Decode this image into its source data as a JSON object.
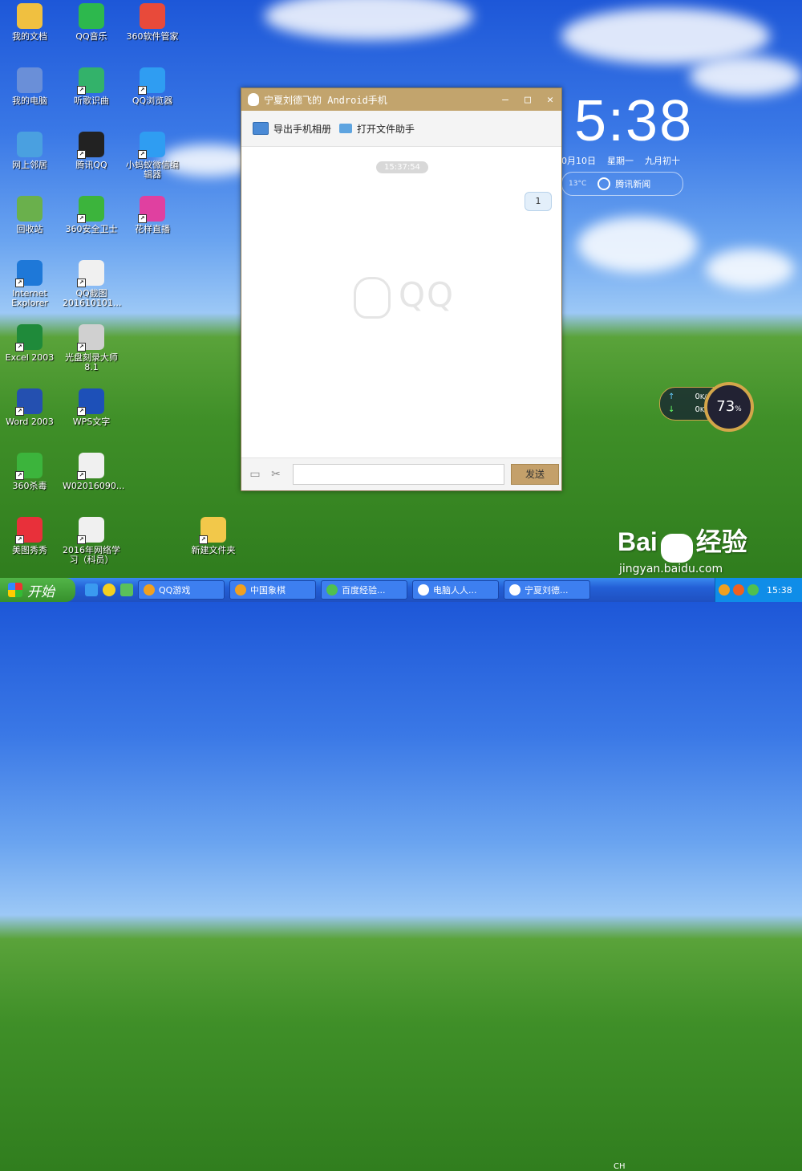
{
  "desktop": {
    "icons": [
      {
        "label": "我的文档",
        "icon": "folder-docs-icon",
        "color": "#f0c040"
      },
      {
        "label": "QQ音乐",
        "icon": "qq-music-icon",
        "color": "#2db84d"
      },
      {
        "label": "360软件管家",
        "icon": "360-software-icon",
        "color": "#e84a3a"
      },
      {
        "label": "我的电脑",
        "icon": "my-computer-icon",
        "color": "#6a8fd8"
      },
      {
        "label": "听歌识曲",
        "icon": "song-recognition-icon",
        "color": "#33b26a"
      },
      {
        "label": "QQ浏览器",
        "icon": "qq-browser-icon",
        "color": "#2f9df2"
      },
      {
        "label": "网上邻居",
        "icon": "network-icon",
        "color": "#4aa0e0"
      },
      {
        "label": "腾讯QQ",
        "icon": "tencent-qq-icon",
        "color": "#222222"
      },
      {
        "label": "小蚂蚁微信编\n辑器",
        "icon": "wechat-editor-icon",
        "color": "#2f9df2"
      },
      {
        "label": "回收站",
        "icon": "recycle-bin-icon",
        "color": "#6ab04c"
      },
      {
        "label": "360安全卫士",
        "icon": "360-security-icon",
        "color": "#3cb43c"
      },
      {
        "label": "花样直播",
        "icon": "huayang-live-icon",
        "color": "#e040a0"
      },
      {
        "label": "Internet\nExplorer",
        "icon": "ie-icon",
        "color": "#1e78d8"
      },
      {
        "label": "QQ截图\n201610101...",
        "icon": "qq-screenshot-file-icon",
        "color": "#f0f0f0"
      },
      {
        "label": "Excel 2003",
        "icon": "excel-icon",
        "color": "#1f8a3a"
      },
      {
        "label": "光盘刻录大师\n8.1",
        "icon": "disc-burner-icon",
        "color": "#d0d0d0"
      },
      {
        "label": "Word 2003",
        "icon": "word-icon",
        "color": "#2450b0"
      },
      {
        "label": "WPS文字",
        "icon": "wps-icon",
        "color": "#1d50b8"
      },
      {
        "label": "360杀毒",
        "icon": "360-antivirus-icon",
        "color": "#3cb43c"
      },
      {
        "label": "W02016090...",
        "icon": "word-file-icon",
        "color": "#f0f0f0"
      },
      {
        "label": "美图秀秀",
        "icon": "meitu-icon",
        "color": "#e8303a"
      },
      {
        "label": "2016年网络学\n习（科员）",
        "icon": "network-study-file-icon",
        "color": "#f0f0f0"
      },
      {
        "label": "新建文件夹",
        "icon": "new-folder-icon",
        "color": "#f2c84a"
      }
    ]
  },
  "qq_window": {
    "title": "宁夏刘德飞的 Android手机",
    "toolbar": {
      "export_album": "导出手机相册",
      "open_file_helper": "打开文件助手"
    },
    "timestamp": "15:37:54",
    "message": "1",
    "watermark": "QQ",
    "input_placeholder": "",
    "send_label": "发送",
    "controls": {
      "minimize": "—",
      "maximize": "□",
      "close": "✕"
    }
  },
  "clock": {
    "time": "5:38",
    "date": "0月10日",
    "weekday": "星期一",
    "lunar": "九月初十",
    "weather": "13°C",
    "news_label": "腾讯新闻"
  },
  "speed_widget": {
    "up": "0",
    "down": "0",
    "unit": "K/s",
    "percent": "73",
    "percent_sign": "%"
  },
  "taskbar": {
    "start_label": "开始",
    "tasks": [
      {
        "label": "QQ游戏",
        "color": "#f0a020"
      },
      {
        "label": "中国象棋",
        "color": "#f0a020"
      },
      {
        "label": "百度经验...",
        "color": "#50c050"
      },
      {
        "label": "电脑人人...",
        "color": "#ffffff"
      },
      {
        "label": "宁夏刘德...",
        "color": "#ffffff"
      }
    ],
    "ime": "CH",
    "clock": "15:38"
  },
  "watermark": {
    "brand": "Bai",
    "brand2": "经验",
    "url": "jingyan.baidu.com"
  },
  "colors": {
    "window_title": "#c2a46d",
    "send_button": "#c4a06a",
    "taskbar": "#235fd6",
    "start_button": "#36902c"
  }
}
